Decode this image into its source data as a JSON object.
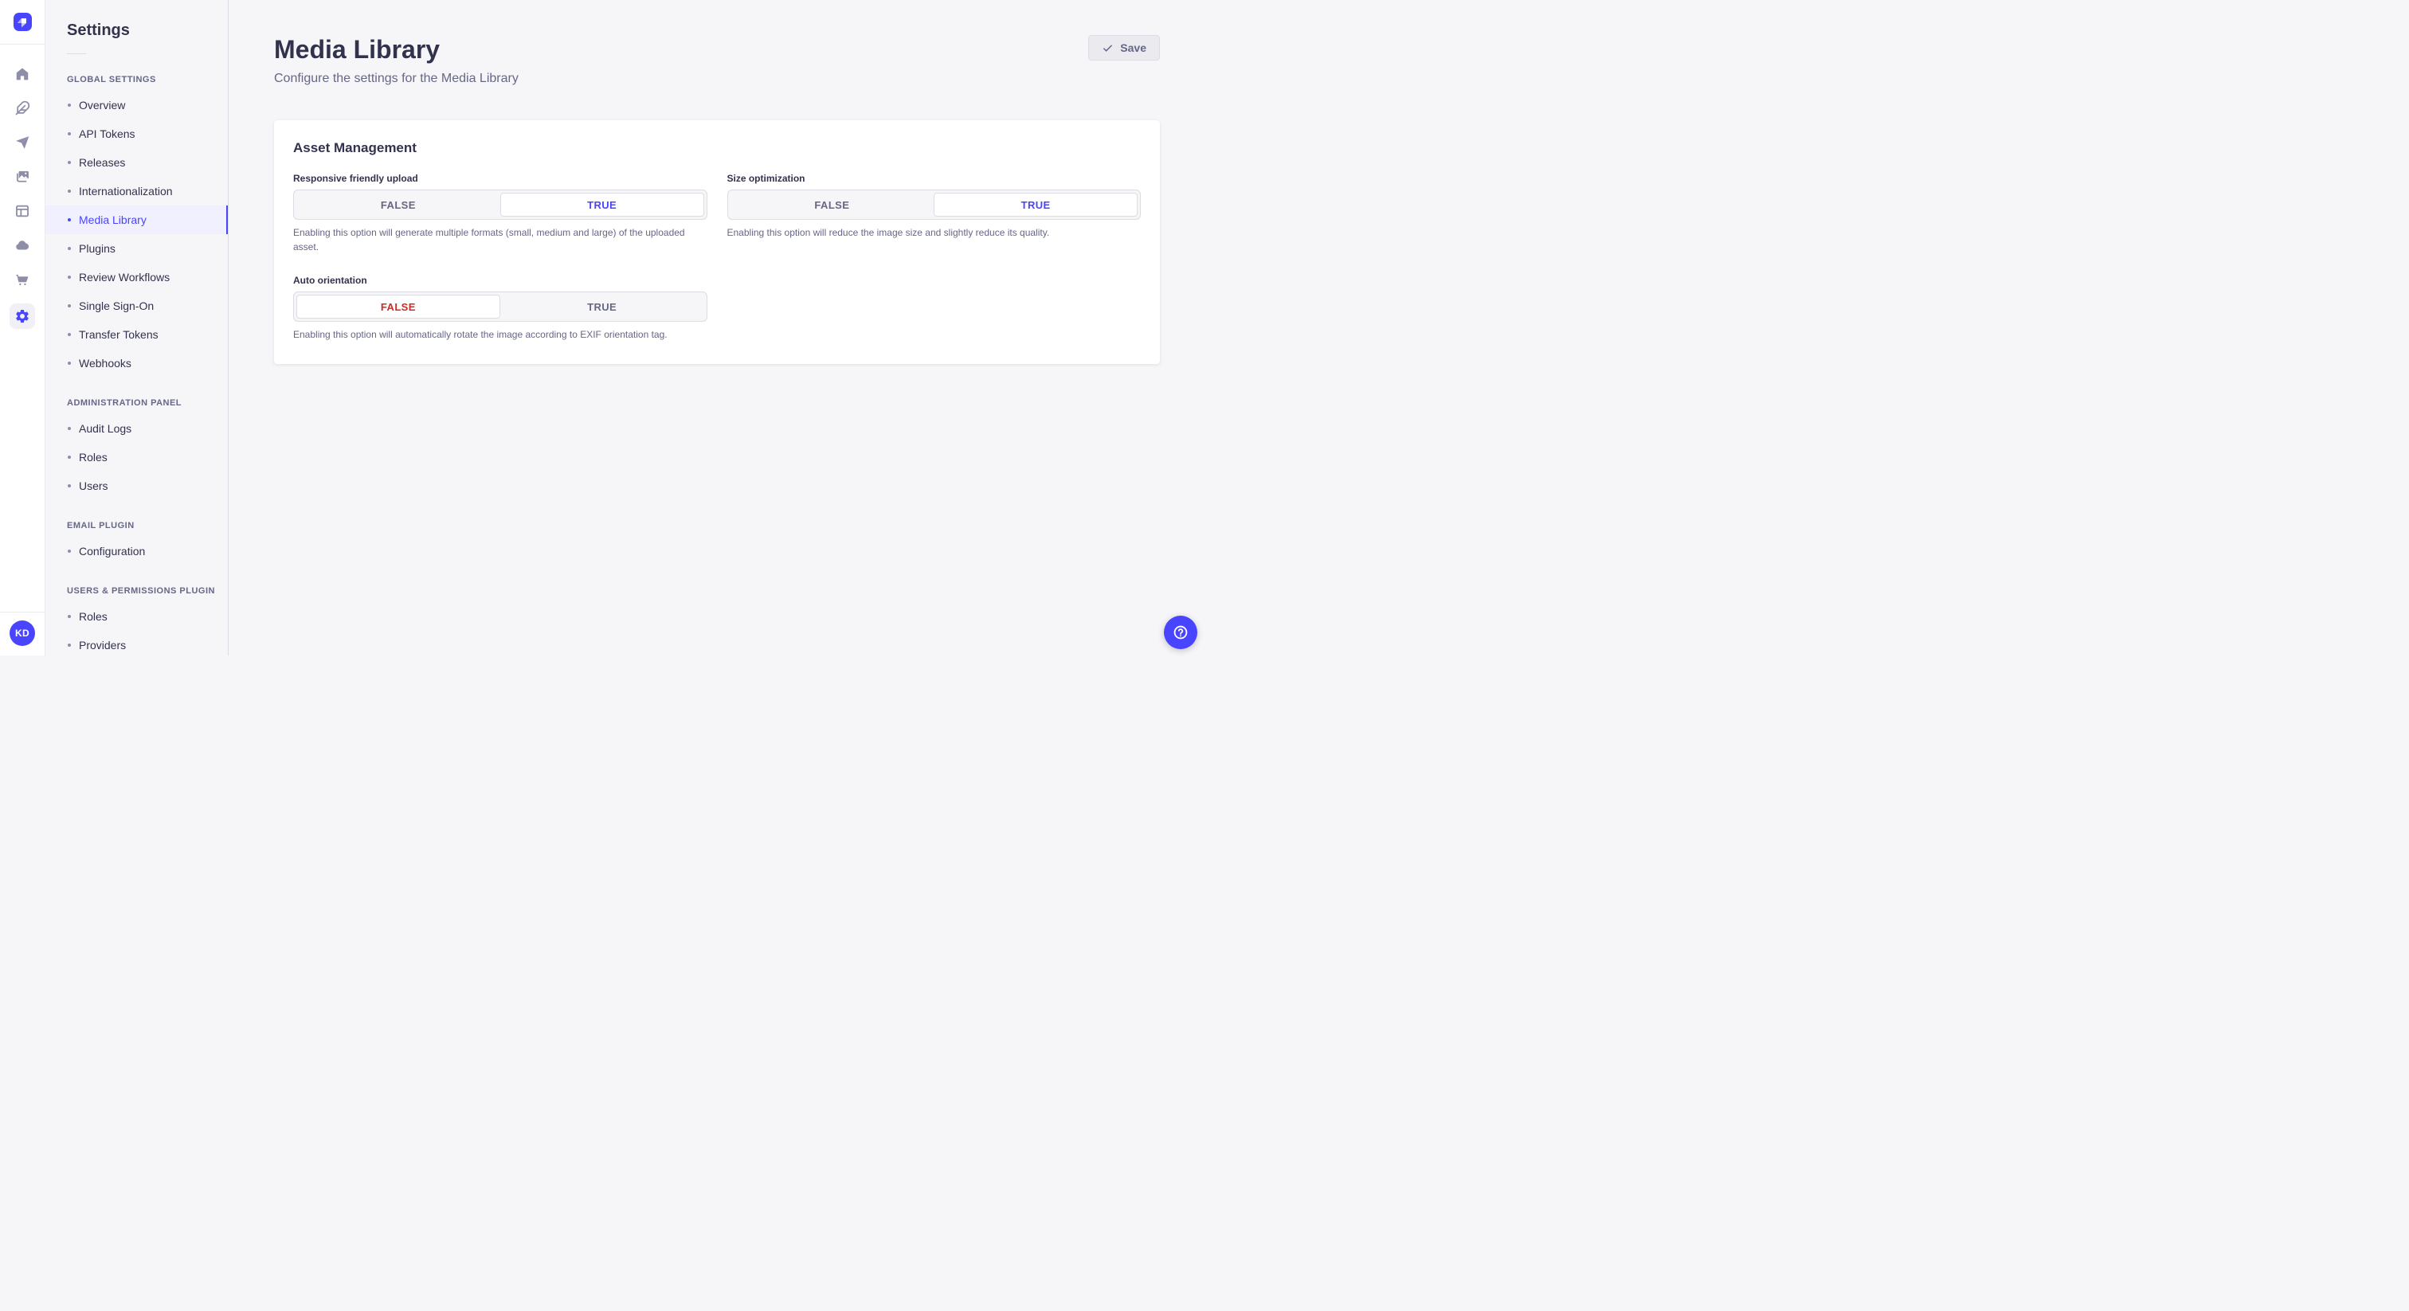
{
  "colors": {
    "primary": "#4945ff",
    "primary_light_bg": "#f0f0ff",
    "danger": "#d02b20",
    "text": "#32324d",
    "text_muted": "#666687",
    "border": "#dcdce4",
    "page_bg": "#f6f6f9"
  },
  "rail": {
    "logo_icon": "strapi-logo",
    "items": [
      {
        "icon": "home-icon",
        "active": false
      },
      {
        "icon": "feather-icon",
        "active": false
      },
      {
        "icon": "paper-plane-icon",
        "active": false
      },
      {
        "icon": "media-images-icon",
        "active": false
      },
      {
        "icon": "layout-window-icon",
        "active": false
      },
      {
        "icon": "cloud-icon",
        "active": false
      },
      {
        "icon": "cart-icon",
        "active": false
      },
      {
        "icon": "gear-icon",
        "active": true
      }
    ],
    "avatar_initials": "KD"
  },
  "sidebar": {
    "title": "Settings",
    "sections": [
      {
        "label": "GLOBAL SETTINGS",
        "items": [
          {
            "label": "Overview",
            "active": false
          },
          {
            "label": "API Tokens",
            "active": false
          },
          {
            "label": "Releases",
            "active": false
          },
          {
            "label": "Internationalization",
            "active": false
          },
          {
            "label": "Media Library",
            "active": true
          },
          {
            "label": "Plugins",
            "active": false
          },
          {
            "label": "Review Workflows",
            "active": false
          },
          {
            "label": "Single Sign-On",
            "active": false
          },
          {
            "label": "Transfer Tokens",
            "active": false
          },
          {
            "label": "Webhooks",
            "active": false
          }
        ]
      },
      {
        "label": "ADMINISTRATION PANEL",
        "items": [
          {
            "label": "Audit Logs",
            "active": false
          },
          {
            "label": "Roles",
            "active": false
          },
          {
            "label": "Users",
            "active": false
          }
        ]
      },
      {
        "label": "EMAIL PLUGIN",
        "items": [
          {
            "label": "Configuration",
            "active": false
          }
        ]
      },
      {
        "label": "USERS & PERMISSIONS PLUGIN",
        "items": [
          {
            "label": "Roles",
            "active": false
          },
          {
            "label": "Providers",
            "active": false
          }
        ]
      }
    ]
  },
  "header": {
    "title": "Media Library",
    "subtitle": "Configure the settings for the Media Library",
    "save_label": "Save",
    "save_icon": "check-icon"
  },
  "panel": {
    "section_title": "Asset Management",
    "fields": [
      {
        "label": "Responsive friendly upload",
        "options": [
          "FALSE",
          "TRUE"
        ],
        "value": "TRUE",
        "hint": "Enabling this option will generate multiple formats (small, medium and large) of the uploaded asset."
      },
      {
        "label": "Size optimization",
        "options": [
          "FALSE",
          "TRUE"
        ],
        "value": "TRUE",
        "hint": "Enabling this option will reduce the image size and slightly reduce its quality."
      },
      {
        "label": "Auto orientation",
        "options": [
          "FALSE",
          "TRUE"
        ],
        "value": "FALSE",
        "hint": "Enabling this option will automatically rotate the image according to EXIF orientation tag."
      }
    ]
  },
  "fab": {
    "icon": "question-circle-icon"
  }
}
